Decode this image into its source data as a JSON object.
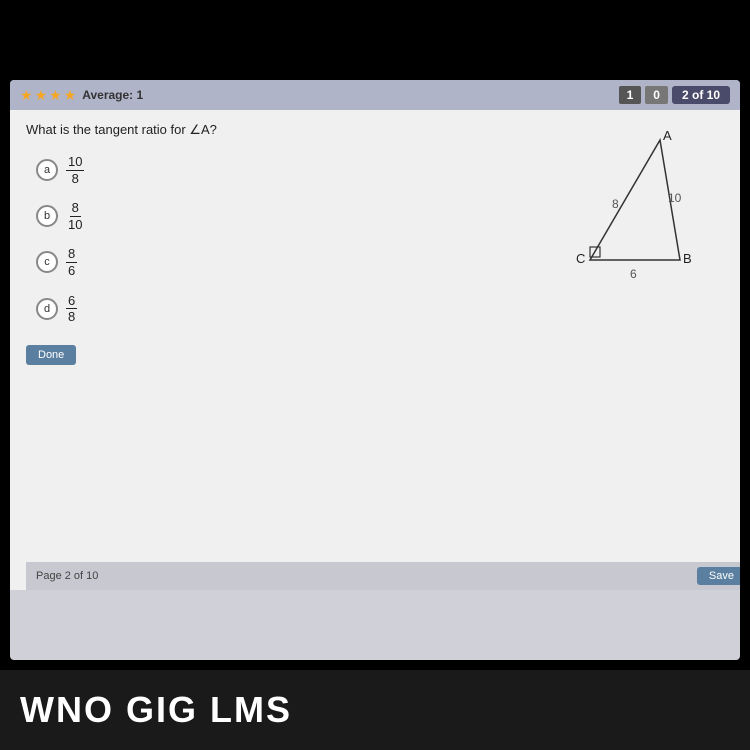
{
  "header": {
    "stars_count": 4,
    "average_label": "Average: 1",
    "score_correct": "1",
    "score_wrong": "0",
    "page_indicator": "2 of 10"
  },
  "question": {
    "text": "What is the tangent ratio for ∠A?"
  },
  "answers": [
    {
      "id": "a",
      "label": "a",
      "numerator": "10",
      "denominator": "8"
    },
    {
      "id": "b",
      "label": "b",
      "numerator": "8",
      "denominator": "10"
    },
    {
      "id": "c",
      "label": "c",
      "numerator": "8",
      "denominator": "6"
    },
    {
      "id": "d",
      "label": "d",
      "numerator": "6",
      "denominator": "8"
    }
  ],
  "triangle": {
    "vertex_a": "A",
    "vertex_b": "B",
    "vertex_c": "C",
    "side_ac": "8",
    "side_ab": "10",
    "side_bc": "6"
  },
  "buttons": {
    "done": "Done",
    "save": "Save"
  },
  "footer": {
    "page_text": "Page 2 of 10"
  },
  "bottom_text": "WNO GIG LMS"
}
